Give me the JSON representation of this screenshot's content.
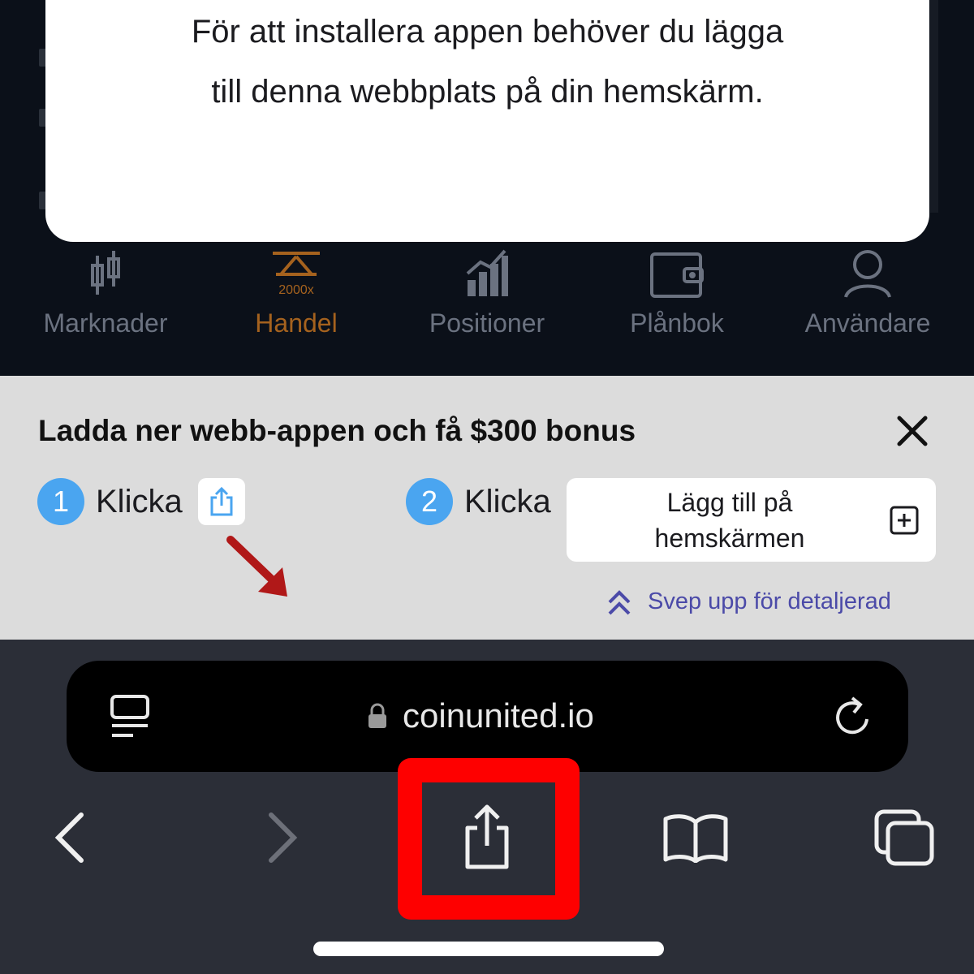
{
  "modal": {
    "line1": "För att installera appen behöver du lägga",
    "line2": "till denna webbplats på din hemskärm."
  },
  "app_nav": {
    "items": [
      {
        "label": "Marknader",
        "icon": "candlestick-icon",
        "active": false
      },
      {
        "label": "Handel",
        "icon": "trade-leverage-icon",
        "active": true,
        "badge": "2000x"
      },
      {
        "label": "Positioner",
        "icon": "bar-chart-icon",
        "active": false
      },
      {
        "label": "Plånbok",
        "icon": "wallet-icon",
        "active": false
      },
      {
        "label": "Användare",
        "icon": "user-icon",
        "active": false
      }
    ]
  },
  "banner": {
    "title": "Ladda ner webb-appen och få $300 bonus",
    "step1": {
      "number": "1",
      "label": "Klicka"
    },
    "step2": {
      "number": "2",
      "label": "Klicka"
    },
    "add_home": {
      "line1": "Lägg till på",
      "line2": "hemskärmen"
    },
    "swipe_hint": "Svep upp för detaljerad"
  },
  "safari": {
    "url": "coinunited.io"
  },
  "colors": {
    "accent_active": "#a5621e",
    "step_circle": "#4aa5f0",
    "highlight_box": "#fe0000",
    "swipe_text": "#4b4aa8"
  }
}
